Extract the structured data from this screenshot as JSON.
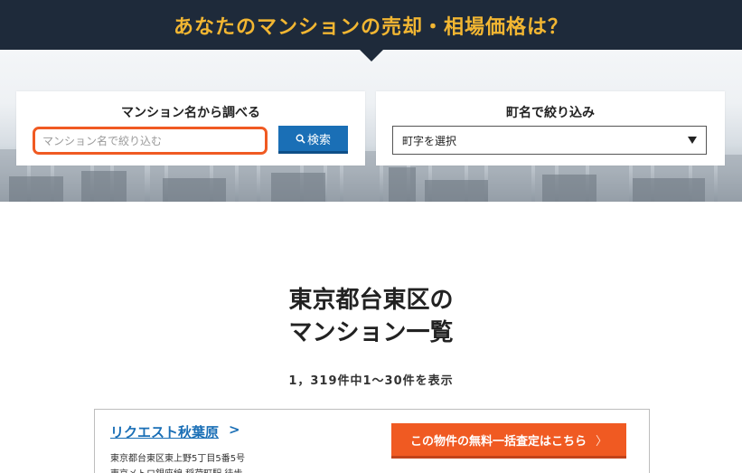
{
  "header": {
    "title": "あなたのマンションの売却・相場価格は？"
  },
  "search_panel": {
    "heading": "マンション名から調べる",
    "input_value": "",
    "input_placeholder": "マンション名で絞り込む",
    "search_button_label": "検索",
    "search_icon": "search-icon"
  },
  "town_panel": {
    "heading": "町名で絞り込み",
    "selected_value": "町字を選択",
    "arrow_icon": "caret-down-icon"
  },
  "main": {
    "title_line1": "東京都台東区の",
    "title_line2": "マンション一覧",
    "count_text": "1，319件中1～30件を表示"
  },
  "listing": {
    "name": "リクエスト秋葉原",
    "name_arrow": ">",
    "address": "東京都台東区東上野5丁目5番5号",
    "access": "東京メトロ銀座線 稲荷町駅 徒歩...",
    "appraisal_button_label": "この物件の無料一括査定はこちら",
    "appraisal_chevron": "〉"
  },
  "colors": {
    "banner_bg": "#1e2a3a",
    "banner_text": "#f2b632",
    "accent_orange": "#f05a22",
    "accent_blue": "#1a6fb6"
  }
}
